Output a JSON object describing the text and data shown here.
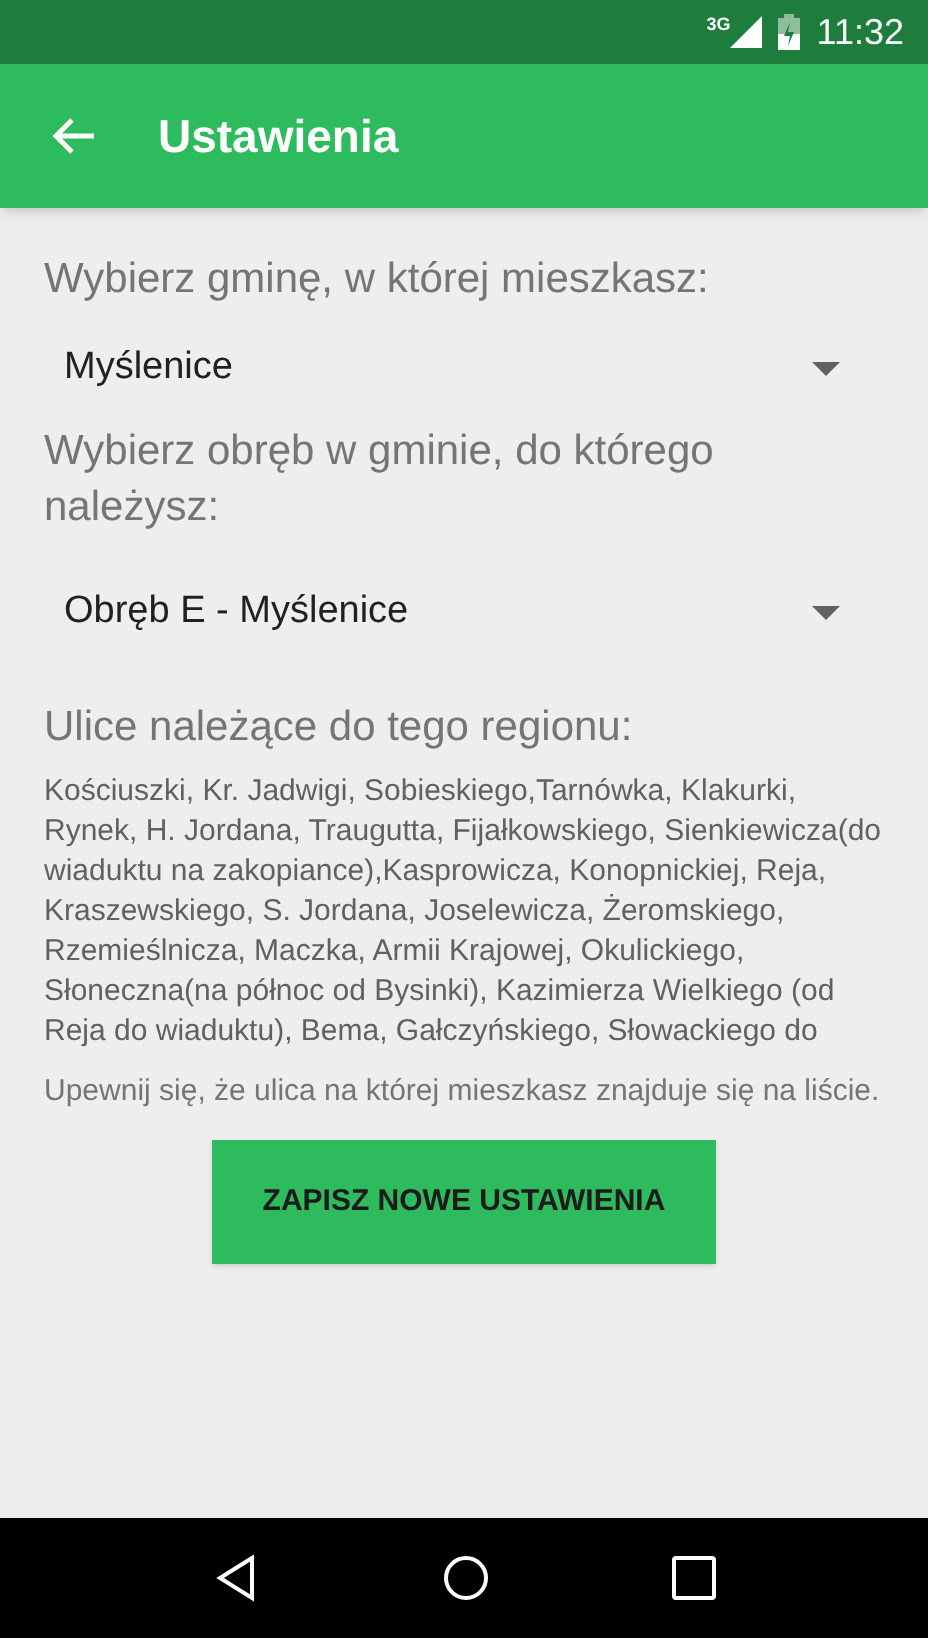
{
  "status_bar": {
    "time": "11:32",
    "network": "3G"
  },
  "app_bar": {
    "title": "Ustawienia"
  },
  "commune": {
    "label": "Wybierz gminę, w której mieszkasz:",
    "value": "Myślenice"
  },
  "district": {
    "label": "Wybierz obręb w gminie, do którego należysz:",
    "value": "Obręb E - Myślenice"
  },
  "streets": {
    "label": "Ulice należące do tego regionu:",
    "text": "Kościuszki, Kr. Jadwigi, Sobieskiego,Tarnówka, Klakurki, Rynek, H. Jordana, Traugutta, Fijałkowskiego, Sienkiewicza(do wiaduktu na zakopiance),Kasprowicza, Konopnickiej, Reja, Kraszewskiego, S. Jordana, Joselewicza, Żeromskiego, Rzemieślnicza, Maczka, Armii Krajowej, Okulickiego, Słoneczna(na północ od Bysinki), Kazimierza Wielkiego (od Reja do wiaduktu), Bema, Gałczyńskiego, Słowackiego do"
  },
  "note": "Upewnij się, że ulica na której mieszkasz znajduje się na liście.",
  "save_button": "ZAPISZ NOWE USTAWIENIA"
}
